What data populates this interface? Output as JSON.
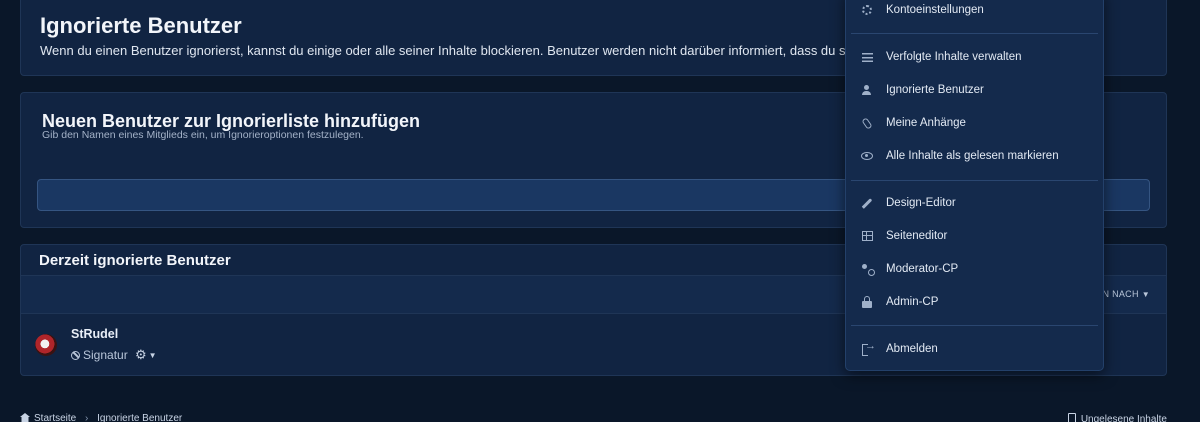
{
  "header": {
    "title": "Ignorierte Benutzer",
    "description": "Wenn du einen Benutzer ignorierst, kannst du einige oder alle seiner Inhalte blockieren. Benutzer werden nicht darüber informiert, dass du sie ignoc"
  },
  "add_panel": {
    "title": "Neuen Benutzer zur Ignorierliste hinzufügen",
    "hint": "Gib den Namen eines Mitglieds ein, um Ignorieroptionen festzulegen.",
    "input_value": ""
  },
  "list_panel": {
    "title": "Derzeit ignorierte Benutzer",
    "sort_label": "N NACH",
    "users": [
      {
        "name": "StRudel",
        "ignored_content": "Signatur"
      }
    ]
  },
  "menu": {
    "items": [
      {
        "label": "Kontoeinstellungen",
        "icon": "gear-icon"
      },
      {
        "label": "Verfolgte Inhalte verwalten",
        "icon": "list-icon"
      },
      {
        "label": "Ignorierte Benutzer",
        "icon": "user-x-icon"
      },
      {
        "label": "Meine Anhänge",
        "icon": "paperclip-icon"
      },
      {
        "label": "Alle Inhalte als gelesen markieren",
        "icon": "eye-icon"
      },
      {
        "label": "Design-Editor",
        "icon": "brush-icon"
      },
      {
        "label": "Seiteneditor",
        "icon": "grid-icon"
      },
      {
        "label": "Moderator-CP",
        "icon": "moderator-icon"
      },
      {
        "label": "Admin-CP",
        "icon": "lock-icon"
      },
      {
        "label": "Abmelden",
        "icon": "logout-icon"
      }
    ]
  },
  "footer": {
    "breadcrumb": [
      "Startseite",
      "Ignorierte Benutzer"
    ],
    "right_link": "Ungelesene Inhalte"
  }
}
